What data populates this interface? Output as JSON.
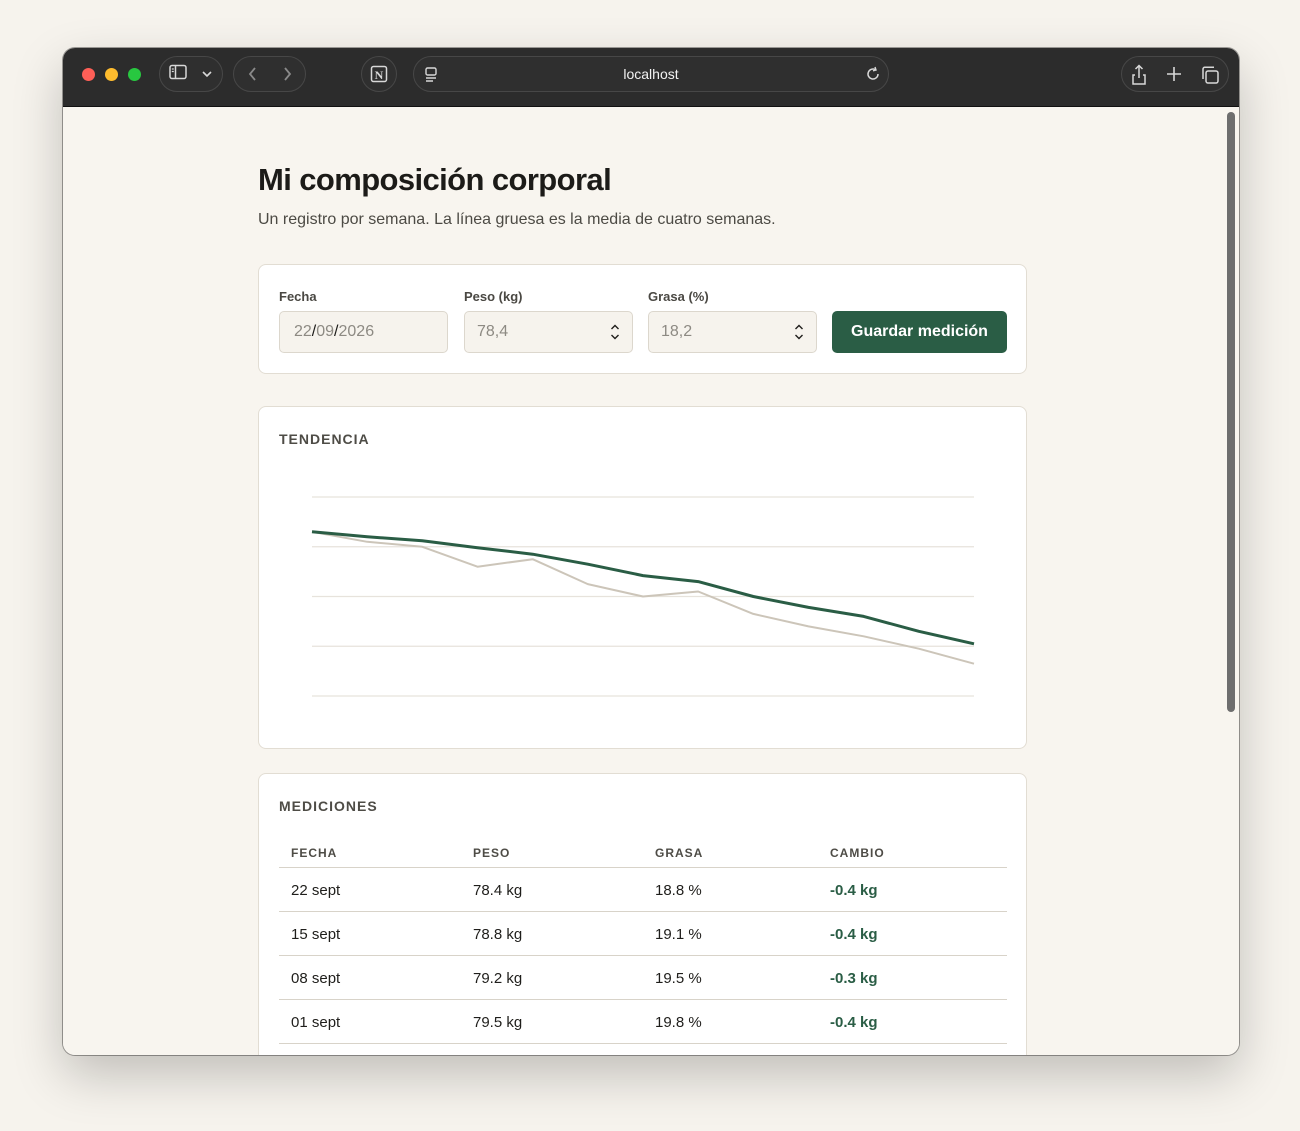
{
  "browser": {
    "url": "localhost"
  },
  "page": {
    "title": "Mi composición corporal",
    "subtitle": "Un registro por semana. La línea gruesa es la media de cuatro semanas."
  },
  "form": {
    "date_label": "Fecha",
    "date_day": "22",
    "date_month": "09",
    "date_year": "2026",
    "weight_label": "Peso (kg)",
    "weight_value": "78,4",
    "fat_label": "Grasa (%)",
    "fat_value": "18,2",
    "save_label": "Guardar medición"
  },
  "trend": {
    "title": "TENDENCIA"
  },
  "chart_data": {
    "type": "line",
    "title": "TENDENCIA",
    "xlabel": "",
    "ylabel": "",
    "grid": true,
    "ylim": [
      0,
      4
    ],
    "series": [
      {
        "style": "thin",
        "color": "#ccc5b9",
        "values": [
          3.3,
          3.1,
          3.0,
          2.6,
          2.75,
          2.25,
          2.0,
          2.1,
          1.65,
          1.4,
          1.2,
          0.95,
          0.65
        ]
      },
      {
        "style": "thick",
        "color": "#2a5d45",
        "values": [
          3.3,
          3.2,
          3.12,
          2.98,
          2.85,
          2.65,
          2.42,
          2.3,
          2.0,
          1.78,
          1.6,
          1.3,
          1.05
        ]
      }
    ]
  },
  "measurements": {
    "title": "MEDICIONES",
    "headers": [
      "FECHA",
      "PESO",
      "GRASA",
      "CAMBIO"
    ],
    "rows": [
      {
        "date": "22 sept",
        "weight": "78.4 kg",
        "fat": "18.8 %",
        "change": "-0.4 kg"
      },
      {
        "date": "15 sept",
        "weight": "78.8 kg",
        "fat": "19.1 %",
        "change": "-0.4 kg"
      },
      {
        "date": "08 sept",
        "weight": "79.2 kg",
        "fat": "19.5 %",
        "change": "-0.3 kg"
      },
      {
        "date": "01 sept",
        "weight": "79.5 kg",
        "fat": "19.8 %",
        "change": "-0.4 kg"
      }
    ]
  }
}
